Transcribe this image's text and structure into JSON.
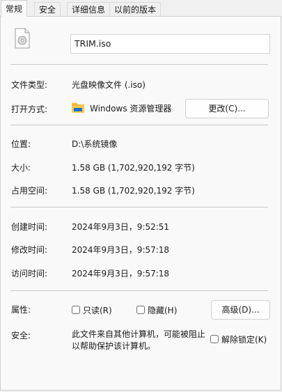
{
  "tabs": [
    "常规",
    "安全",
    "详细信息",
    "以前的版本"
  ],
  "file_name": "TRIM.iso",
  "rows": {
    "type": {
      "label": "文件类型:",
      "value": "光盘映像文件 (.iso)"
    },
    "open_with": {
      "label": "打开方式:",
      "value": "Windows 资源管理器",
      "button": "更改(C)..."
    },
    "location": {
      "label": "位置:",
      "value": "D:\\系统镜像"
    },
    "size": {
      "label": "大小:",
      "value": "1.58 GB (1,702,920,192 字节)"
    },
    "size_on_disk": {
      "label": "占用空间:",
      "value": "1.58 GB (1,702,920,192 字节)"
    },
    "created": {
      "label": "创建时间:",
      "value": "2024年9月3日，9:52:51"
    },
    "modified": {
      "label": "修改时间:",
      "value": "2024年9月3日，9:57:18"
    },
    "accessed": {
      "label": "访问时间:",
      "value": "2024年9月3日，9:57:18"
    }
  },
  "attributes": {
    "label": "属性:",
    "readonly": "只读(R)",
    "hidden": "隐藏(H)",
    "advanced_button": "高级(D)...",
    "readonly_checked": false,
    "hidden_checked": false
  },
  "security": {
    "label": "安全:",
    "line1": "此文件来自其他计算机，可能被阻止",
    "line2": "以帮助保护该计算机。",
    "unblock": "解除锁定(K)",
    "unblock_checked": false
  },
  "icons": {
    "file": "disc-image-file-icon",
    "open_with_app": "file-explorer-folder-icon"
  },
  "colors": {
    "panel_bg": "#f9f9f9",
    "separator": "#c8c8c8",
    "folder_yellow": "#f4b73a",
    "folder_blue": "#1e73c8"
  }
}
